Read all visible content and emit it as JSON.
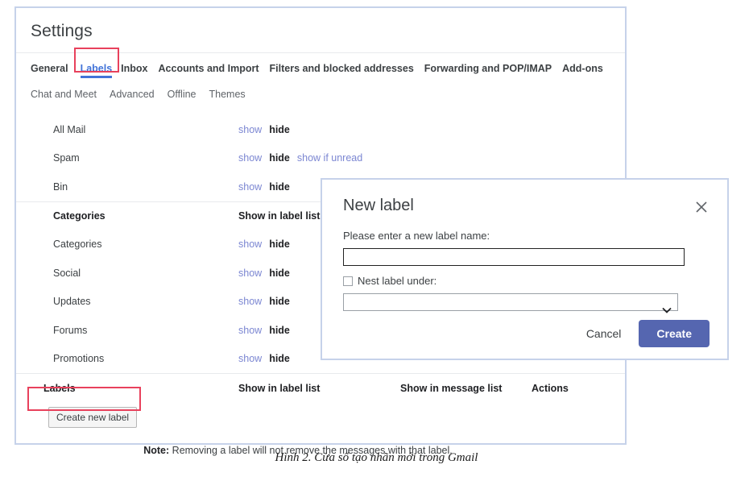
{
  "settings": {
    "title": "Settings",
    "tabs_row1": [
      {
        "label": "General",
        "active": false
      },
      {
        "label": "Labels",
        "active": true
      },
      {
        "label": "Inbox",
        "active": false
      },
      {
        "label": "Accounts and Import",
        "active": false
      },
      {
        "label": "Filters and blocked addresses",
        "active": false
      },
      {
        "label": "Forwarding and POP/IMAP",
        "active": false
      },
      {
        "label": "Add-ons",
        "active": false
      }
    ],
    "tabs_row2": [
      {
        "label": "Chat and Meet"
      },
      {
        "label": "Advanced"
      },
      {
        "label": "Offline"
      },
      {
        "label": "Themes"
      }
    ],
    "system_labels": [
      {
        "name": "All Mail",
        "actions": [
          "show",
          "hide"
        ]
      },
      {
        "name": "Spam",
        "actions": [
          "show",
          "hide",
          "show if unread"
        ]
      },
      {
        "name": "Bin",
        "actions": [
          "show",
          "hide"
        ]
      }
    ],
    "categories_header": {
      "col1": "Categories",
      "col2": "Show in label list"
    },
    "categories": [
      {
        "name": "Categories",
        "actions": [
          "show",
          "hide"
        ]
      },
      {
        "name": "Social",
        "actions": [
          "show",
          "hide"
        ]
      },
      {
        "name": "Updates",
        "actions": [
          "show",
          "hide"
        ]
      },
      {
        "name": "Forums",
        "actions": [
          "show",
          "hide"
        ]
      },
      {
        "name": "Promotions",
        "actions": [
          "show",
          "hide"
        ]
      }
    ],
    "labels_header": {
      "col1": "Labels",
      "col2": "Show in label list",
      "col3": "Show in message list",
      "col4": "Actions"
    },
    "create_new_label_button": "Create new label",
    "note_prefix": "Note:",
    "note_text": " Removing a label will not remove the messages with that label."
  },
  "dialog": {
    "title": "New label",
    "close_icon": "close-icon",
    "prompt": "Please enter a new label name:",
    "label_name_value": "",
    "label_name_placeholder": "",
    "nest_checkbox_label": "Nest label under:",
    "nest_checkbox_checked": false,
    "nest_select_value": "",
    "nest_select_options": [
      ""
    ],
    "cancel_label": "Cancel",
    "create_label": "Create"
  },
  "caption": "Hình 2. Cửa sổ tạo nhãn mới trong Gmail",
  "colors": {
    "panel_border": "#c6d2ea",
    "active_tab": "#4273d8",
    "link": "#7b86d2",
    "annotation": "#e8415c",
    "create_button": "#5566b0",
    "text_primary": "#3c4043",
    "text_muted": "#5f6368"
  }
}
